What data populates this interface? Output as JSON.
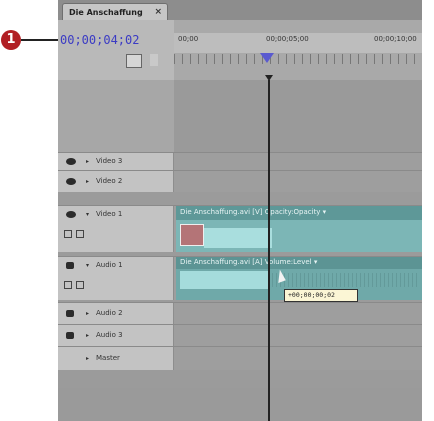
{
  "callout": {
    "number": "1"
  },
  "tab": {
    "label": "Die Anschaffung",
    "close": "×"
  },
  "timecode": "00;00;04;02",
  "ruler": {
    "labels": [
      "00;00",
      "00;00;05;00",
      "00;00;10;00"
    ]
  },
  "tracks": {
    "video3": {
      "label": "Video 3"
    },
    "video2": {
      "label": "Video 2"
    },
    "video1": {
      "label": "Video 1",
      "clip_title": "Die Anschaffung.avi [V] Opacity:Opacity ▾"
    },
    "audio1": {
      "label": "Audio 1",
      "clip_title": "Die Anschaffung.avi [A] Volume:Level ▾"
    },
    "audio2": {
      "label": "Audio 2"
    },
    "audio3": {
      "label": "Audio 3"
    },
    "master": {
      "label": "Master"
    }
  },
  "tooltip": "+00;00;00;02",
  "icons": {
    "eye": "eye-icon",
    "speaker": "speaker-icon",
    "marker": "playhead-marker"
  }
}
